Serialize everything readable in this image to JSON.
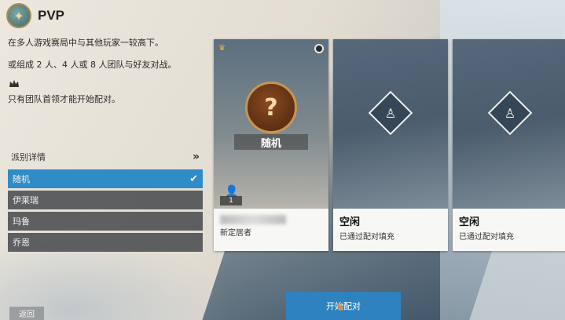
{
  "header": {
    "title": "PVP",
    "logo_icon": "faction-emblem-icon"
  },
  "description": {
    "line1": "在多人游戏赛局中与其他玩家一较高下。",
    "line2": "或组成 2 人、4 人或 8 人团队与好友对战。",
    "leader_note": "只有团队首领才能开始配对。"
  },
  "factions": {
    "header_label": "派别详情",
    "items": [
      {
        "label": "随机",
        "selected": true
      },
      {
        "label": "伊莱瑞",
        "selected": false
      },
      {
        "label": "玛鲁",
        "selected": false
      },
      {
        "label": "乔恩",
        "selected": false
      }
    ]
  },
  "cards": [
    {
      "art_label": "随机",
      "hero_glyph": "?",
      "count": "1",
      "name": "",
      "subtitle": "新定居者"
    },
    {
      "name": "空闲",
      "subtitle": "已通过配对填充"
    },
    {
      "name": "空闲",
      "subtitle": "已通过配对填充"
    }
  ],
  "actions": {
    "start_label": "开始配对",
    "back_label": "返回"
  },
  "colors": {
    "accent": "#2f82c0",
    "selected": "#2f8cc6",
    "list_bg": "#4a4c50"
  }
}
